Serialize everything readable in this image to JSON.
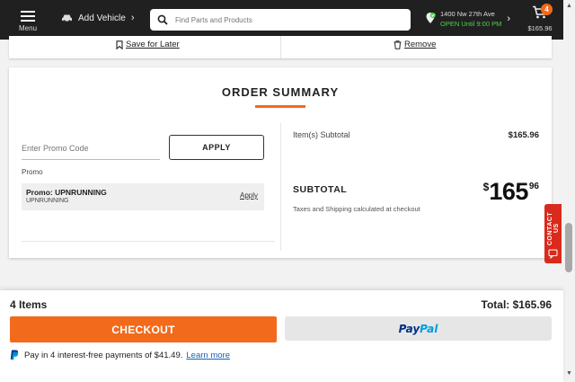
{
  "header": {
    "menu_label": "Menu",
    "add_vehicle_label": "Add Vehicle",
    "search_placeholder": "Find Parts and Products",
    "store_address": "1400 Nw 27th Ave",
    "store_hours": "OPEN Until 9:00 PM",
    "cart_count": "4",
    "cart_total": "$165.96"
  },
  "item_actions": {
    "save_for_later": "Save for Later",
    "remove": "Remove"
  },
  "order_summary": {
    "title": "ORDER SUMMARY",
    "promo_placeholder": "Enter Promo Code",
    "apply_button": "APPLY",
    "promo_label": "Promo",
    "promo_name": "Promo: UPNRUNNING",
    "promo_code": "UPNRUNNING",
    "promo_apply": "Apply",
    "items_subtotal_label": "Item(s) Subtotal",
    "items_subtotal_value": "$165.96",
    "subtotal_label": "SUBTOTAL",
    "subtotal_currency": "$",
    "subtotal_dollars": "165",
    "subtotal_cents": "96",
    "tax_note": "Taxes and Shipping calculated at checkout"
  },
  "contact_tab": {
    "label": "CONTACT US"
  },
  "checkout_bar": {
    "items_count": "4 Items",
    "total": "Total: $165.96",
    "checkout_button": "CHECKOUT",
    "paypal_pay": "Pay",
    "paypal_pal": "Pal",
    "pay_later_text": "Pay in 4 interest-free payments of $41.49.",
    "learn_more": "Learn more"
  },
  "colors": {
    "accent": "#f26a1b",
    "header_bg": "#202020",
    "store_open": "#4fd14f",
    "contact_tab": "#d92a1c",
    "paypal_dark": "#003087",
    "paypal_light": "#009cde"
  }
}
